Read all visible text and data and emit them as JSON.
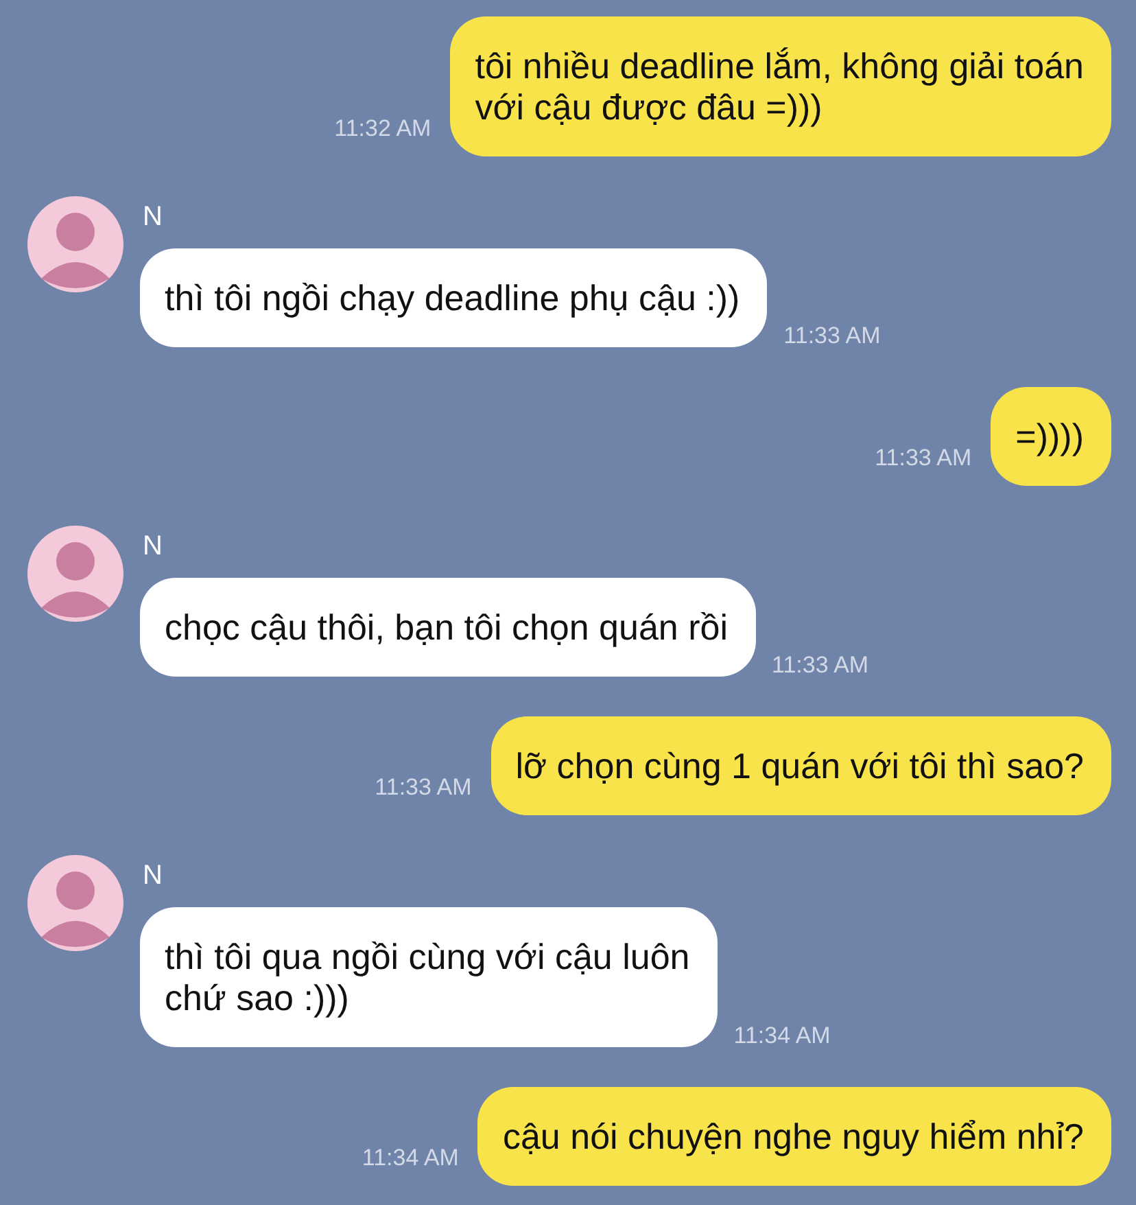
{
  "messages": [
    {
      "kind": "sent",
      "text": "tôi nhiều deadline lắm, không giải toán\nvới cậu được đâu =)))",
      "time": "11:32 AM"
    },
    {
      "kind": "received",
      "sender": "N",
      "text": "thì tôi ngồi chạy deadline phụ cậu :))",
      "time": "11:33 AM"
    },
    {
      "kind": "sent",
      "text": "=))))",
      "time": "11:33 AM"
    },
    {
      "kind": "received",
      "sender": "N",
      "text": "chọc cậu thôi, bạn tôi chọn quán rồi",
      "time": "11:33 AM"
    },
    {
      "kind": "sent",
      "text": "lỡ chọn cùng 1 quán với tôi thì sao?",
      "time": "11:33 AM"
    },
    {
      "kind": "received",
      "sender": "N",
      "text": "thì tôi qua ngồi cùng với cậu luôn\nchứ sao :)))",
      "time": "11:34 AM"
    },
    {
      "kind": "sent",
      "text": "cậu nói chuyện nghe nguy hiểm nhỉ?",
      "time": "11:34 AM"
    }
  ]
}
